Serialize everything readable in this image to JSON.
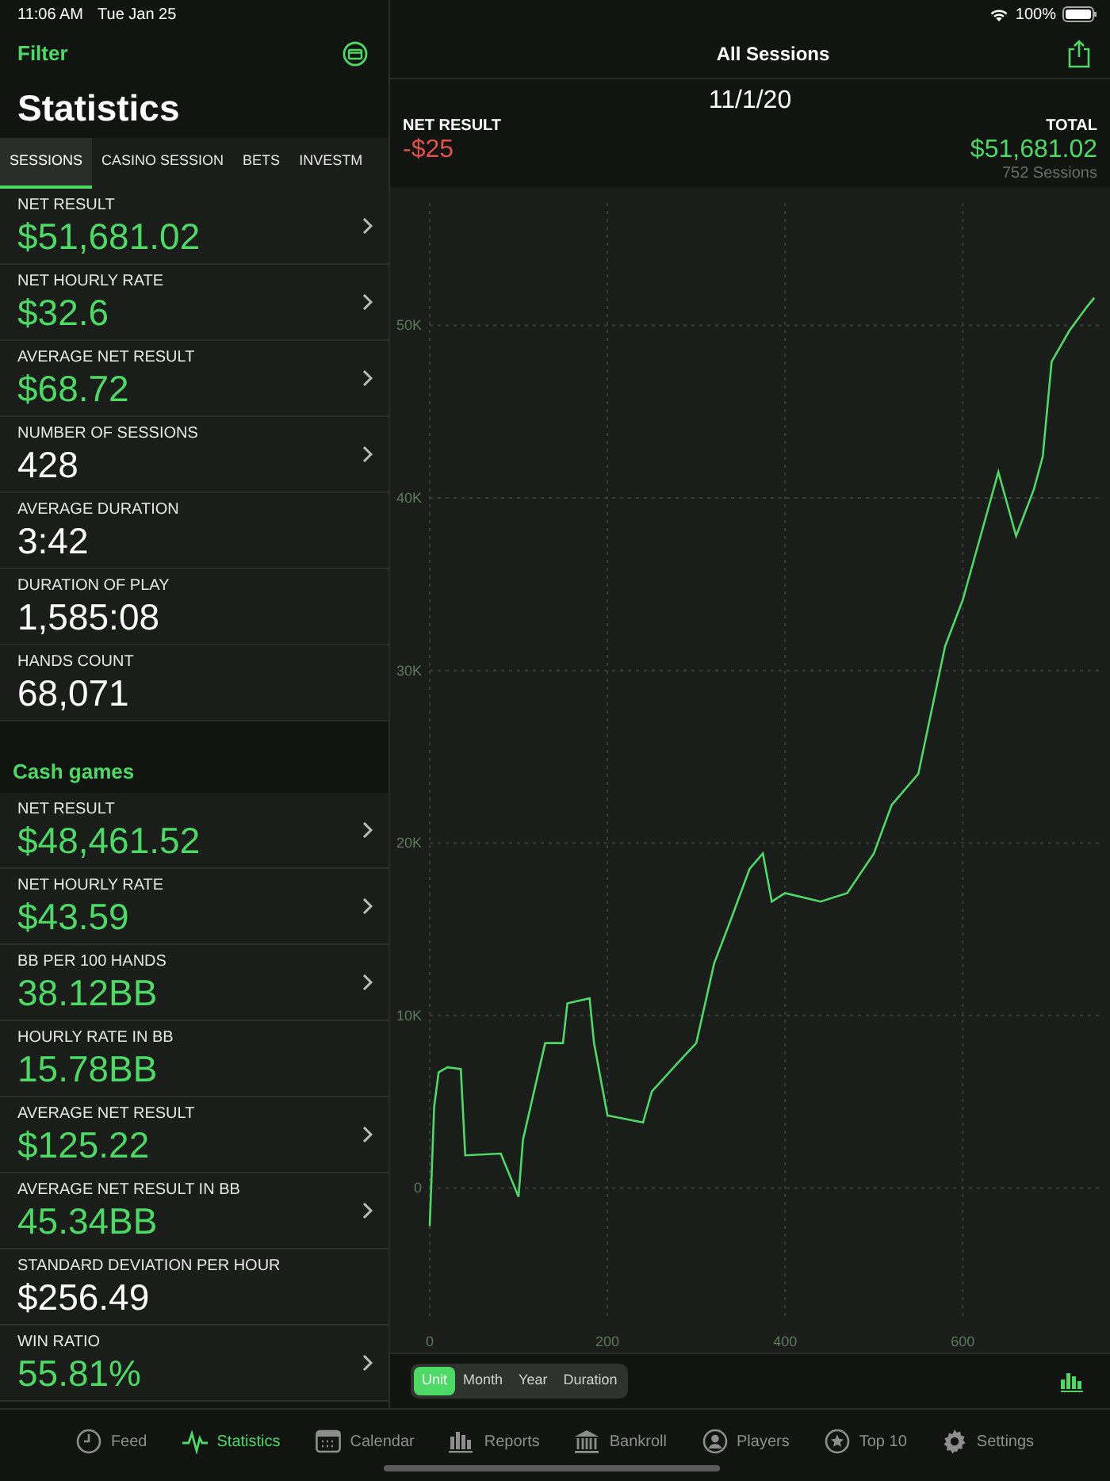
{
  "status_bar": {
    "time": "11:06 AM",
    "date": "Tue Jan 25",
    "battery": "100%"
  },
  "sidebar": {
    "filter": "Filter",
    "title": "Statistics",
    "tabs": [
      {
        "label": "SESSIONS",
        "selected": true
      },
      {
        "label": "CASINO SESSION",
        "selected": false
      },
      {
        "label": "BETS",
        "selected": false
      },
      {
        "label": "INVESTM",
        "selected": false
      }
    ],
    "stats": [
      {
        "label": "NET RESULT",
        "value": "$51,681.02",
        "color": "#4cd964",
        "chevron": true
      },
      {
        "label": "NET HOURLY RATE",
        "value": "$32.6",
        "color": "#4cd964",
        "chevron": true
      },
      {
        "label": "AVERAGE NET RESULT",
        "value": "$68.72",
        "color": "#4cd964",
        "chevron": true
      },
      {
        "label": "NUMBER OF SESSIONS",
        "value": "428",
        "color": "#ffffff",
        "chevron": true
      },
      {
        "label": "AVERAGE DURATION",
        "value": "3:42",
        "color": "#ffffff",
        "chevron": false
      },
      {
        "label": "DURATION OF PLAY",
        "value": "1,585:08",
        "color": "#ffffff",
        "chevron": false
      },
      {
        "label": "HANDS COUNT",
        "value": "68,071",
        "color": "#ffffff",
        "chevron": false
      }
    ],
    "section": "Cash games",
    "cash_stats": [
      {
        "label": "NET RESULT",
        "value": "$48,461.52",
        "color": "#4cd964",
        "chevron": true
      },
      {
        "label": "NET HOURLY RATE",
        "value": "$43.59",
        "color": "#4cd964",
        "chevron": true
      },
      {
        "label": "BB PER 100 HANDS",
        "value": "38.12BB",
        "color": "#4cd964",
        "chevron": true
      },
      {
        "label": "HOURLY RATE IN BB",
        "value": "15.78BB",
        "color": "#4cd964",
        "chevron": false
      },
      {
        "label": "AVERAGE NET RESULT",
        "value": "$125.22",
        "color": "#4cd964",
        "chevron": true
      },
      {
        "label": "AVERAGE NET RESULT IN BB",
        "value": "45.34BB",
        "color": "#4cd964",
        "chevron": true
      },
      {
        "label": "STANDARD DEVIATION PER HOUR",
        "value": "$256.49",
        "color": "#ffffff",
        "chevron": false
      },
      {
        "label": "WIN RATIO",
        "value": "55.81%",
        "color": "#4cd964",
        "chevron": true
      }
    ]
  },
  "detail": {
    "title": "All Sessions",
    "date": "11/1/20",
    "net_label": "NET RESULT",
    "net_value": "-$25",
    "total_label": "TOTAL",
    "total_value": "$51,681.02",
    "sessions": "752 Sessions",
    "chart_data": {
      "type": "line",
      "x": [
        0,
        5,
        10,
        20,
        35,
        40,
        80,
        100,
        105,
        130,
        150,
        155,
        180,
        185,
        200,
        240,
        250,
        280,
        300,
        320,
        340,
        360,
        375,
        385,
        400,
        440,
        470,
        500,
        520,
        550,
        580,
        600,
        620,
        640,
        660,
        680,
        690,
        700,
        720,
        740,
        748
      ],
      "series": [
        {
          "color": "#4cd964",
          "values": [
            -2200,
            4700,
            6700,
            7000,
            6900,
            1900,
            2000,
            -500,
            2800,
            8400,
            8400,
            10700,
            11000,
            8400,
            4200,
            3800,
            5600,
            7300,
            8400,
            13000,
            15700,
            18500,
            19400,
            16600,
            17100,
            16600,
            17100,
            19400,
            22200,
            24000,
            31400,
            34100,
            37800,
            41500,
            37800,
            40500,
            42400,
            47900,
            49700,
            51100,
            51600
          ]
        }
      ],
      "xlim": [
        0,
        755
      ],
      "ylim": [
        -7700,
        57100
      ],
      "grid": true,
      "xticks": [
        0,
        200,
        400,
        600
      ],
      "yticks": [
        {
          "value": 0,
          "label": "0"
        },
        {
          "value": 10000,
          "label": "10K"
        },
        {
          "value": 20000,
          "label": "20K"
        },
        {
          "value": 30000,
          "label": "30K"
        },
        {
          "value": 40000,
          "label": "40K"
        },
        {
          "value": 50000,
          "label": "50K"
        }
      ]
    },
    "segments": [
      {
        "label": "Unit",
        "selected": true
      },
      {
        "label": "Month",
        "selected": false
      },
      {
        "label": "Year",
        "selected": false
      },
      {
        "label": "Duration",
        "selected": false
      }
    ]
  },
  "tab_bar": [
    {
      "label": "Feed",
      "selected": false
    },
    {
      "label": "Statistics",
      "selected": true
    },
    {
      "label": "Calendar",
      "selected": false
    },
    {
      "label": "Reports",
      "selected": false
    },
    {
      "label": "Bankroll",
      "selected": false
    },
    {
      "label": "Players",
      "selected": false
    },
    {
      "label": "Top 10",
      "selected": false
    },
    {
      "label": "Settings",
      "selected": false
    }
  ]
}
